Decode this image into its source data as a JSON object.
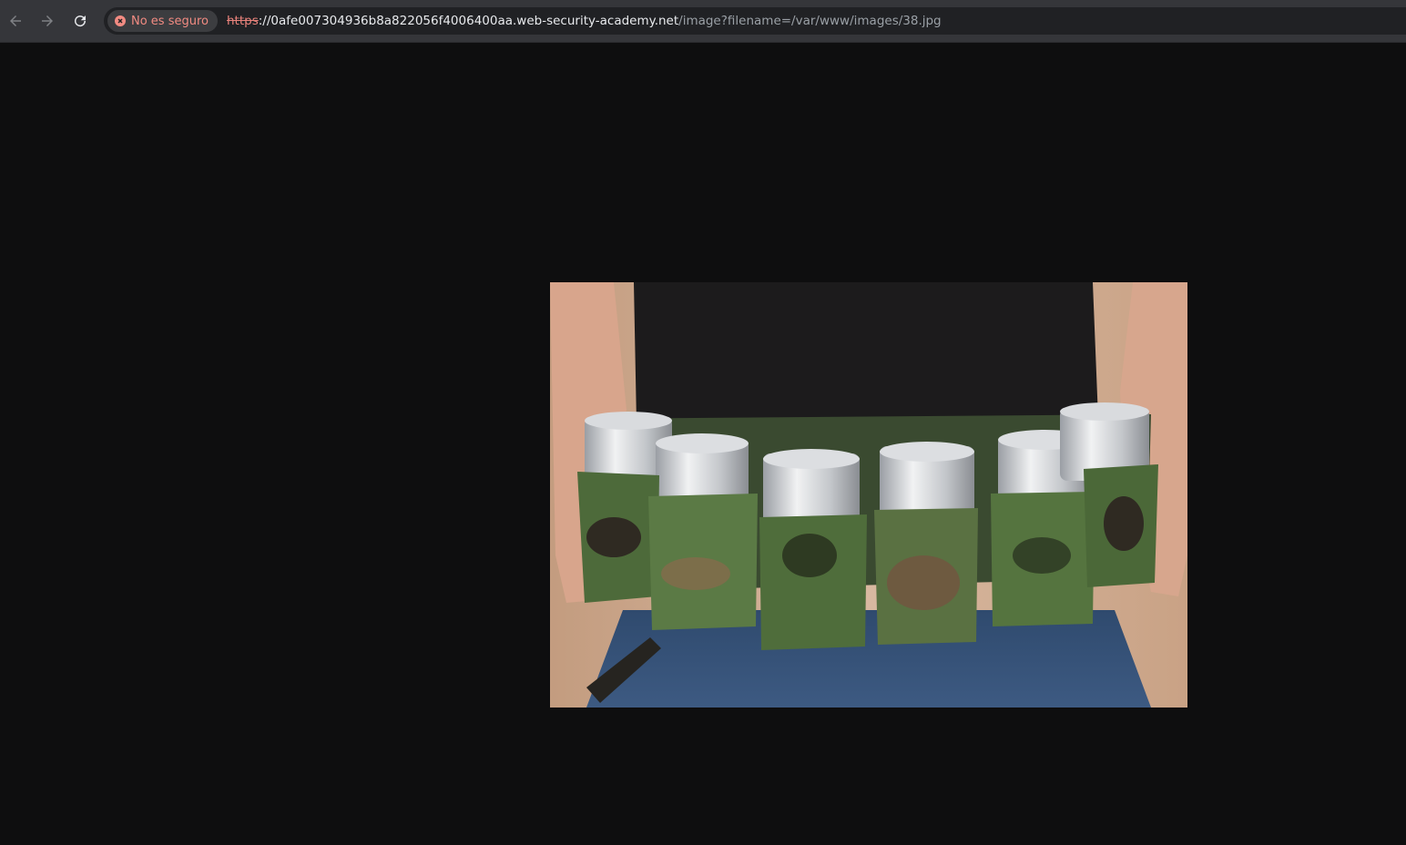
{
  "browser": {
    "security_chip": {
      "label": "No es seguro",
      "icon": "warning-icon",
      "color": "#f28b82"
    },
    "url": {
      "scheme": "https",
      "separator": "://",
      "host": "0afe007304936b8a822056f4006400aa.web-security-academy.net",
      "path": "/image?filename=/var/www/images/38.jpg"
    },
    "nav": {
      "back_icon": "back-arrow-icon",
      "forward_icon": "forward-arrow-icon",
      "reload_icon": "reload-icon"
    }
  },
  "viewer": {
    "image_subject": "belt with six camouflage can holders worn over jeans",
    "background": "#0e0e0f"
  }
}
